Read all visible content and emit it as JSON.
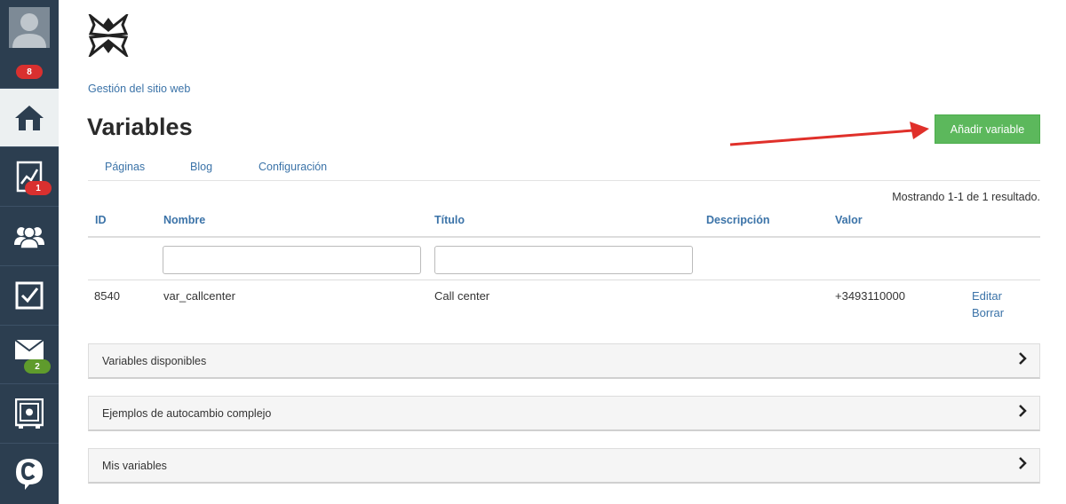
{
  "sidebar": {
    "notification_badge": "8",
    "reports_badge": "1",
    "mail_badge": "2"
  },
  "breadcrumb": "Gestión del sitio web",
  "page_title": "Variables",
  "add_button_label": "Añadir variable",
  "tabs": [
    {
      "label": "Páginas"
    },
    {
      "label": "Blog"
    },
    {
      "label": "Configuración"
    }
  ],
  "summary": "Mostrando 1-1 de 1 resultado.",
  "table": {
    "headers": [
      "ID",
      "Nombre",
      "Título",
      "Descripción",
      "Valor"
    ],
    "rows": [
      {
        "id": "8540",
        "nombre": "var_callcenter",
        "titulo": "Call center",
        "descripcion": "",
        "valor": "+3493110000",
        "edit": "Editar",
        "delete": "Borrar"
      }
    ]
  },
  "panels": [
    {
      "label": "Variables disponibles"
    },
    {
      "label": "Ejemplos de autocambio complejo"
    },
    {
      "label": "Mis variables"
    }
  ],
  "colors": {
    "sidebar": "#2c3e50",
    "link": "#3b73a8",
    "primary_button": "#5cb85c",
    "arrow": "#e0302a"
  }
}
